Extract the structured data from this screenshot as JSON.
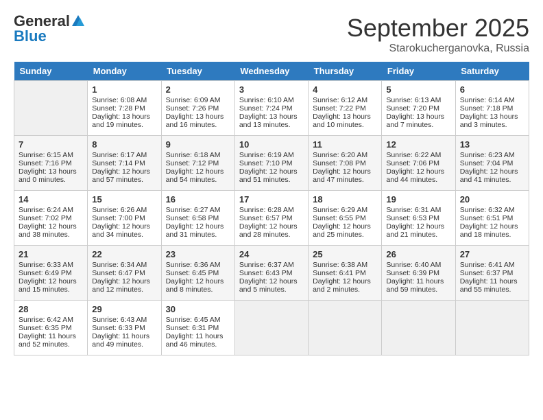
{
  "header": {
    "logo_general": "General",
    "logo_blue": "Blue",
    "month_title": "September 2025",
    "location": "Starokucherganovka, Russia"
  },
  "days_of_week": [
    "Sunday",
    "Monday",
    "Tuesday",
    "Wednesday",
    "Thursday",
    "Friday",
    "Saturday"
  ],
  "weeks": [
    [
      {
        "day": "",
        "info": ""
      },
      {
        "day": "1",
        "info": "Sunrise: 6:08 AM\nSunset: 7:28 PM\nDaylight: 13 hours\nand 19 minutes."
      },
      {
        "day": "2",
        "info": "Sunrise: 6:09 AM\nSunset: 7:26 PM\nDaylight: 13 hours\nand 16 minutes."
      },
      {
        "day": "3",
        "info": "Sunrise: 6:10 AM\nSunset: 7:24 PM\nDaylight: 13 hours\nand 13 minutes."
      },
      {
        "day": "4",
        "info": "Sunrise: 6:12 AM\nSunset: 7:22 PM\nDaylight: 13 hours\nand 10 minutes."
      },
      {
        "day": "5",
        "info": "Sunrise: 6:13 AM\nSunset: 7:20 PM\nDaylight: 13 hours\nand 7 minutes."
      },
      {
        "day": "6",
        "info": "Sunrise: 6:14 AM\nSunset: 7:18 PM\nDaylight: 13 hours\nand 3 minutes."
      }
    ],
    [
      {
        "day": "7",
        "info": "Sunrise: 6:15 AM\nSunset: 7:16 PM\nDaylight: 13 hours\nand 0 minutes."
      },
      {
        "day": "8",
        "info": "Sunrise: 6:17 AM\nSunset: 7:14 PM\nDaylight: 12 hours\nand 57 minutes."
      },
      {
        "day": "9",
        "info": "Sunrise: 6:18 AM\nSunset: 7:12 PM\nDaylight: 12 hours\nand 54 minutes."
      },
      {
        "day": "10",
        "info": "Sunrise: 6:19 AM\nSunset: 7:10 PM\nDaylight: 12 hours\nand 51 minutes."
      },
      {
        "day": "11",
        "info": "Sunrise: 6:20 AM\nSunset: 7:08 PM\nDaylight: 12 hours\nand 47 minutes."
      },
      {
        "day": "12",
        "info": "Sunrise: 6:22 AM\nSunset: 7:06 PM\nDaylight: 12 hours\nand 44 minutes."
      },
      {
        "day": "13",
        "info": "Sunrise: 6:23 AM\nSunset: 7:04 PM\nDaylight: 12 hours\nand 41 minutes."
      }
    ],
    [
      {
        "day": "14",
        "info": "Sunrise: 6:24 AM\nSunset: 7:02 PM\nDaylight: 12 hours\nand 38 minutes."
      },
      {
        "day": "15",
        "info": "Sunrise: 6:26 AM\nSunset: 7:00 PM\nDaylight: 12 hours\nand 34 minutes."
      },
      {
        "day": "16",
        "info": "Sunrise: 6:27 AM\nSunset: 6:58 PM\nDaylight: 12 hours\nand 31 minutes."
      },
      {
        "day": "17",
        "info": "Sunrise: 6:28 AM\nSunset: 6:57 PM\nDaylight: 12 hours\nand 28 minutes."
      },
      {
        "day": "18",
        "info": "Sunrise: 6:29 AM\nSunset: 6:55 PM\nDaylight: 12 hours\nand 25 minutes."
      },
      {
        "day": "19",
        "info": "Sunrise: 6:31 AM\nSunset: 6:53 PM\nDaylight: 12 hours\nand 21 minutes."
      },
      {
        "day": "20",
        "info": "Sunrise: 6:32 AM\nSunset: 6:51 PM\nDaylight: 12 hours\nand 18 minutes."
      }
    ],
    [
      {
        "day": "21",
        "info": "Sunrise: 6:33 AM\nSunset: 6:49 PM\nDaylight: 12 hours\nand 15 minutes."
      },
      {
        "day": "22",
        "info": "Sunrise: 6:34 AM\nSunset: 6:47 PM\nDaylight: 12 hours\nand 12 minutes."
      },
      {
        "day": "23",
        "info": "Sunrise: 6:36 AM\nSunset: 6:45 PM\nDaylight: 12 hours\nand 8 minutes."
      },
      {
        "day": "24",
        "info": "Sunrise: 6:37 AM\nSunset: 6:43 PM\nDaylight: 12 hours\nand 5 minutes."
      },
      {
        "day": "25",
        "info": "Sunrise: 6:38 AM\nSunset: 6:41 PM\nDaylight: 12 hours\nand 2 minutes."
      },
      {
        "day": "26",
        "info": "Sunrise: 6:40 AM\nSunset: 6:39 PM\nDaylight: 11 hours\nand 59 minutes."
      },
      {
        "day": "27",
        "info": "Sunrise: 6:41 AM\nSunset: 6:37 PM\nDaylight: 11 hours\nand 55 minutes."
      }
    ],
    [
      {
        "day": "28",
        "info": "Sunrise: 6:42 AM\nSunset: 6:35 PM\nDaylight: 11 hours\nand 52 minutes."
      },
      {
        "day": "29",
        "info": "Sunrise: 6:43 AM\nSunset: 6:33 PM\nDaylight: 11 hours\nand 49 minutes."
      },
      {
        "day": "30",
        "info": "Sunrise: 6:45 AM\nSunset: 6:31 PM\nDaylight: 11 hours\nand 46 minutes."
      },
      {
        "day": "",
        "info": ""
      },
      {
        "day": "",
        "info": ""
      },
      {
        "day": "",
        "info": ""
      },
      {
        "day": "",
        "info": ""
      }
    ]
  ]
}
